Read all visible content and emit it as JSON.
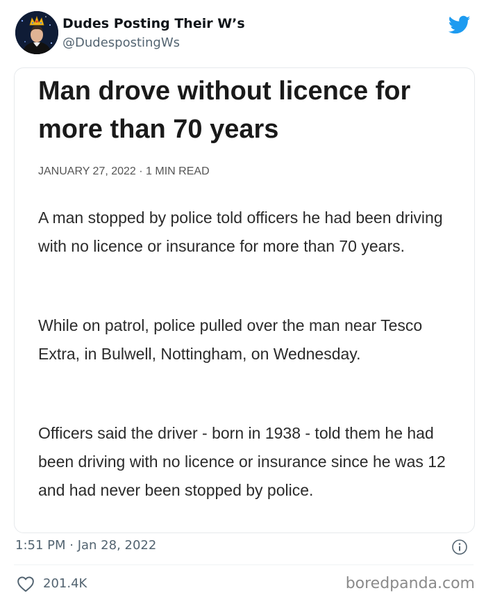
{
  "tweet": {
    "author": {
      "display_name": "Dudes Posting Their W’s",
      "handle": "@DudespostingWs",
      "avatar_icon": "avatar-with-crown"
    },
    "brand_icon": "twitter-bird-icon",
    "brand_color": "#1d9bf0",
    "timestamp": "1:51 PM · Jan 28, 2022",
    "likes": "201.4K"
  },
  "article": {
    "title": "Man drove without licence for more than 70 years",
    "meta": "JANUARY 27, 2022 · 1 MIN READ",
    "paragraphs": [
      "A man stopped by police told officers he had been driving with no licence or insurance for more than 70 years.",
      "While on patrol, police pulled over the man near Tesco Extra, in Bulwell, Nottingham, on Wednesday.",
      "Officers said the driver - born in 1938 - told them he had been driving with no licence or insurance since he was 12 and had never been stopped by police."
    ]
  },
  "watermark": "boredpanda.com"
}
